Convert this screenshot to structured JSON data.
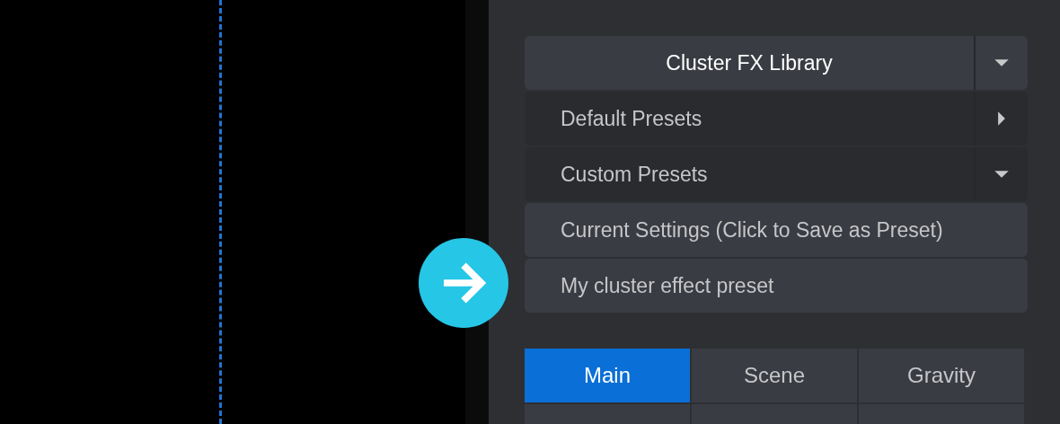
{
  "library": {
    "title": "Cluster FX Library",
    "expanded": true
  },
  "items": [
    {
      "kind": "folder",
      "label": "Default Presets",
      "expanded": false
    },
    {
      "kind": "folder",
      "label": "Custom Presets",
      "expanded": true
    },
    {
      "kind": "preset",
      "label": "Current Settings (Click to Save as Preset)"
    },
    {
      "kind": "preset",
      "label": "My cluster effect preset"
    }
  ],
  "tabs": [
    {
      "label": "Main",
      "selected": true
    },
    {
      "label": "Scene",
      "selected": false
    },
    {
      "label": "Gravity",
      "selected": false
    }
  ]
}
